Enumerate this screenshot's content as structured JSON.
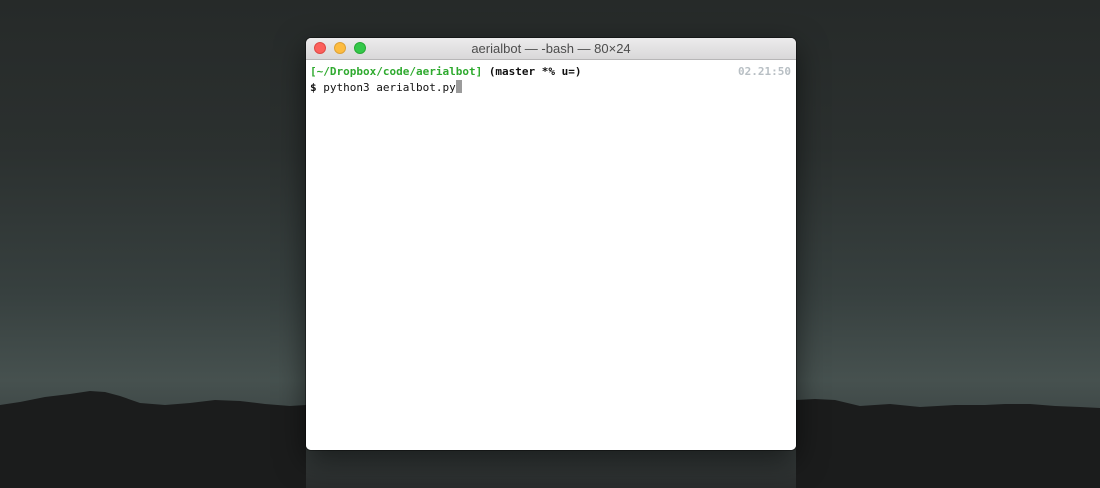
{
  "window": {
    "title": "aerialbot — -bash — 80×24"
  },
  "terminal": {
    "prompt_path": "[~/Dropbox/code/aerialbot]",
    "prompt_branch": "(master *% u=)",
    "prompt_time": "02.21:50",
    "prompt_sign": "$",
    "command": "python3 aerialbot.py"
  },
  "colors": {
    "path_green": "#2faa2f",
    "time_gray": "#b8bfc4",
    "close_red": "#fc605c",
    "minimize_yellow": "#fdbc40",
    "zoom_green": "#34c84a"
  },
  "icons": {
    "close": "close-icon",
    "minimize": "minimize-icon",
    "zoom": "zoom-icon"
  }
}
